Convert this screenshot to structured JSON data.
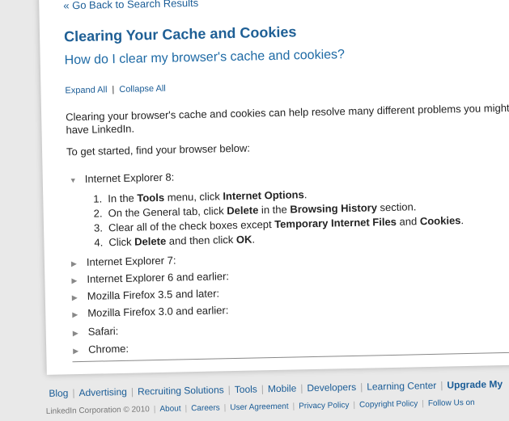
{
  "back_link": "« Go Back to Search Results",
  "title": "Clearing Your Cache and Cookies",
  "subtitle": "How do I clear my browser's cache and cookies?",
  "expand_all": "Expand All",
  "separator": "|",
  "collapse_all": "Collapse All",
  "intro": "Clearing your browser's cache and cookies can help resolve many different problems you might have LinkedIn.",
  "started": "To get started, find your browser below:",
  "browsers": [
    {
      "label": "Internet Explorer 8:",
      "expanded": true
    },
    {
      "label": "Internet Explorer 7:",
      "expanded": false
    },
    {
      "label": "Internet Explorer 6 and earlier:",
      "expanded": false
    },
    {
      "label": "Mozilla Firefox 3.5 and later:",
      "expanded": false
    },
    {
      "label": "Mozilla Firefox 3.0 and earlier:",
      "expanded": false
    },
    {
      "label": "Safari:",
      "expanded": false
    },
    {
      "label": "Chrome:",
      "expanded": false
    }
  ],
  "steps": [
    {
      "num": "1.",
      "a": "In the ",
      "b1": "Tools",
      "c": " menu, click ",
      "b2": "Internet Options",
      "d": "."
    },
    {
      "num": "2.",
      "a": "On the General tab, click ",
      "b1": "Delete",
      "c": " in the ",
      "b2": "Browsing History",
      "d": " section."
    },
    {
      "num": "3.",
      "a": "Clear all of the check boxes except ",
      "b1": "Temporary Internet Files",
      "c": " and ",
      "b2": "Cookies",
      "d": "."
    },
    {
      "num": "4.",
      "a": "Click ",
      "b1": "Delete",
      "c": " and then click ",
      "b2": "OK",
      "d": "."
    }
  ],
  "footer_links": [
    "Blog",
    "Advertising",
    "Recruiting Solutions",
    "Tools",
    "Mobile",
    "Developers",
    "Learning Center",
    "Upgrade My"
  ],
  "footer_copyright": "LinkedIn Corporation © 2010",
  "footer_links2": [
    "About",
    "Careers",
    "User Agreement",
    "Privacy Policy",
    "Copyright Policy",
    "Follow Us on"
  ],
  "colors": {
    "link": "#1a5c96",
    "title": "#1e5f95",
    "text": "#222222"
  }
}
